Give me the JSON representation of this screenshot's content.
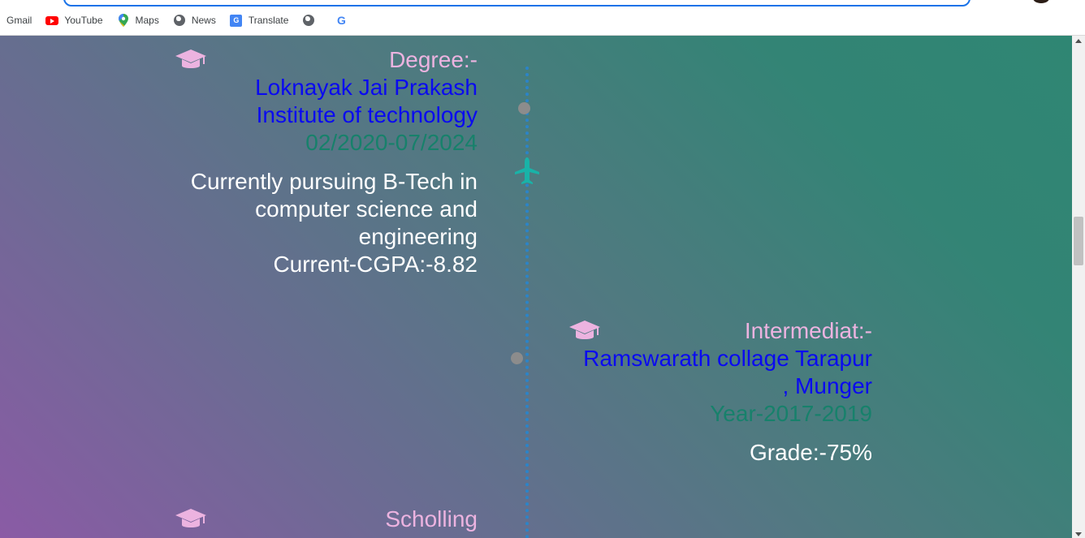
{
  "bookmarks": [
    {
      "label": "Gmail",
      "icon": "gmail-icon"
    },
    {
      "label": "YouTube",
      "icon": "youtube-icon"
    },
    {
      "label": "Maps",
      "icon": "maps-icon"
    },
    {
      "label": "News",
      "icon": "globe-icon"
    },
    {
      "label": "Translate",
      "icon": "translate-icon"
    },
    {
      "label": "",
      "icon": "globe-icon"
    },
    {
      "label": "",
      "icon": "google-icon"
    }
  ],
  "timeline": {
    "degree": {
      "title": "Degree:-",
      "institute_line1": "Loknayak Jai Prakash",
      "institute_line2": "Institute of technology",
      "dates": "02/2020-07/2024",
      "desc_line1": "Currently pursuing B-Tech in",
      "desc_line2": "computer science and",
      "desc_line3": "engineering",
      "desc_line4": "Current-CGPA:-8.82",
      "icon": "graduation-cap-icon"
    },
    "intermediate": {
      "title": "Intermediat:-",
      "institute_line1": "Ramswarath collage Tarapur",
      "institute_line2": ", Munger",
      "dates": "Year-2017-2019",
      "desc_line1": "Grade:-75%",
      "icon": "graduation-cap-icon"
    },
    "schooling": {
      "title": "Scholling",
      "icon": "graduation-cap-icon"
    }
  },
  "colors": {
    "title": "#ecb3e0",
    "institute": "#0a0af0",
    "date": "#17816b",
    "timeline_line": "#2b84c9",
    "plane": "#19b3a8"
  }
}
